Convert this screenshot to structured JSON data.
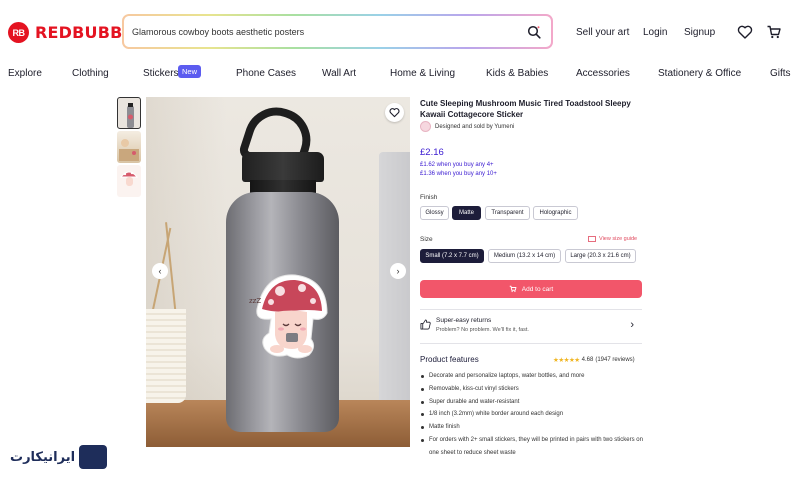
{
  "brand": {
    "logo_mark": "RB",
    "name": "REDBUBBLE",
    "color": "#e41321"
  },
  "search": {
    "value": "Glamorous cowboy boots aesthetic posters",
    "icon": "search-icon"
  },
  "header": {
    "sell": "Sell your art",
    "login": "Login",
    "signup": "Signup",
    "icons": [
      "heart-icon",
      "cart-icon"
    ]
  },
  "categories": [
    "Explore",
    "Clothing",
    "Stickers",
    "Phone Cases",
    "Wall Art",
    "Home & Living",
    "Kids & Babies",
    "Accessories",
    "Stationery & Office",
    "Gifts"
  ],
  "new_badge": "New",
  "product": {
    "title": "Cute Sleeping Mushroom Music Tired Toadstool Sleepy Kawaii Cottagecore Sticker",
    "artist_line": "Designed and sold by Yumeni",
    "price": "£2.16",
    "bulk_prices": [
      "£1.62 when you buy any 4+",
      "£1.36 when you buy any 10+"
    ],
    "finish_label": "Finish",
    "finishes": [
      "Glossy",
      "Matte",
      "Transparent",
      "Holographic"
    ],
    "finish_selected": "Matte",
    "size_label": "Size",
    "size_guide": "View size guide",
    "sizes": [
      "Small (7.2 x 7.7 cm)",
      "Medium (13.2 x 14 cm)",
      "Large (20.3 x 21.6 cm)"
    ],
    "size_selected": "Small (7.2 x 7.7 cm)",
    "add_to_cart": "Add to cart",
    "returns_title": "Super-easy returns",
    "returns_sub": "Problem? No problem. We'll fix it, fast.",
    "features_title": "Product features",
    "rating_stars": "★★★★★",
    "rating_value": "4.68",
    "rating_count": "(1947 reviews)",
    "features": [
      "Decorate and personalize laptops, water bottles, and more",
      "Removable, kiss-cut vinyl stickers",
      "Super durable and water-resistant",
      "1/8 inch (3.2mm) white border around each design",
      "Matte finish",
      "For orders with 2+ small stickers, they will be printed in pairs with two stickers on one sheet to reduce sheet waste"
    ]
  },
  "sticker_text": "zzZ",
  "watermark": "ایرانیکارت"
}
